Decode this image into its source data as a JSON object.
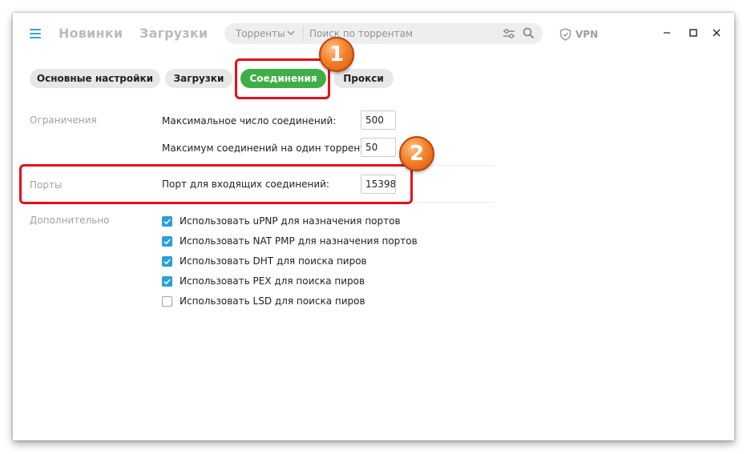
{
  "header": {
    "nav": [
      "Новинки",
      "Загрузки"
    ],
    "search": {
      "category": "Торренты",
      "placeholder": "Поиск по торрентам"
    },
    "vpn_label": "VPN"
  },
  "tabs": [
    {
      "label": "Основные настройки",
      "active": false
    },
    {
      "label": "Загрузки",
      "active": false
    },
    {
      "label": "Соединения",
      "active": true
    },
    {
      "label": "Прокси",
      "active": false
    }
  ],
  "sections": {
    "limits": {
      "label": "Ограничения",
      "fields": [
        {
          "label": "Максимальное число соединений:",
          "value": "500"
        },
        {
          "label": "Максимум соединений на один торрент:",
          "value": "50"
        }
      ]
    },
    "ports": {
      "label": "Порты",
      "fields": [
        {
          "label": "Порт для входящих соединений:",
          "value": "15398"
        }
      ]
    },
    "extra": {
      "label": "Дополнительно",
      "options": [
        {
          "label": "Использовать uPNP для назначения портов",
          "checked": true
        },
        {
          "label": "Использовать NAT PMP для назначения портов",
          "checked": true
        },
        {
          "label": "Использовать DHT для поиска пиров",
          "checked": true
        },
        {
          "label": "Использовать PEX для поиска пиров",
          "checked": true
        },
        {
          "label": "Использовать LSD для поиска пиров",
          "checked": false
        }
      ]
    }
  },
  "annotations": [
    "1",
    "2"
  ],
  "colors": {
    "accent_green": "#3fae47",
    "checkbox_blue": "#2a9fd8",
    "callout_red": "#e3101a",
    "badge_orange": "#f5822a"
  },
  "icons": [
    "hamburger-menu-icon",
    "chevron-down-icon",
    "filter-sliders-icon",
    "search-icon",
    "shield-icon",
    "minimize-icon",
    "maximize-icon",
    "close-icon"
  ]
}
